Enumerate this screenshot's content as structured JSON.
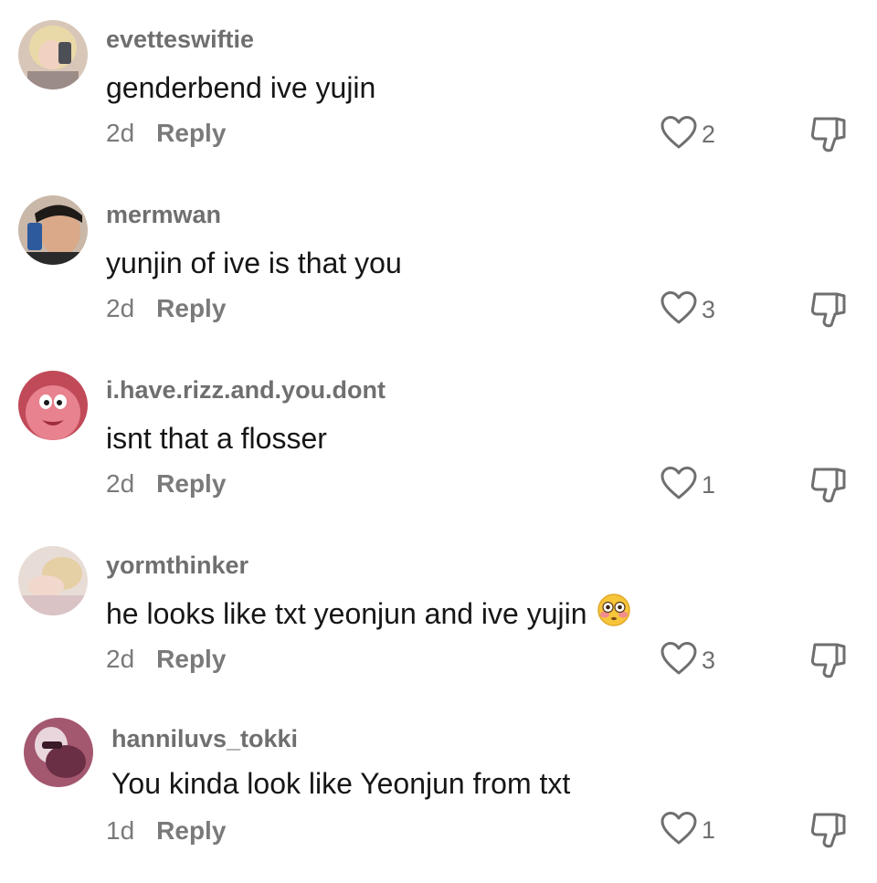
{
  "comments": [
    {
      "username": "evetteswiftie",
      "text": "genderbend ive yujin",
      "time": "2d",
      "reply": "Reply",
      "likes": "2"
    },
    {
      "username": "mermwan",
      "text": "yunjin of ive is that you",
      "time": "2d",
      "reply": "Reply",
      "likes": "3"
    },
    {
      "username": "i.have.rizz.and.you.dont",
      "text": "isnt that a flosser",
      "time": "2d",
      "reply": "Reply",
      "likes": "1"
    },
    {
      "username": "yormthinker",
      "text": "he looks like txt yeonjun and ive yujin",
      "emoji": "flushed-face-emoji",
      "time": "2d",
      "reply": "Reply",
      "likes": "3"
    },
    {
      "username": "hanniluvs_tokki",
      "text": "You kinda look like Yeonjun from txt",
      "time": "1d",
      "reply": "Reply",
      "likes": "1"
    }
  ],
  "colors": {
    "username": "#6f6f6f",
    "text": "#161616",
    "meta": "#7a7a7a",
    "icon_stroke": "#6f6f6f"
  },
  "icons": {
    "like": "heart-outline-icon",
    "dislike": "thumbs-down-icon"
  }
}
